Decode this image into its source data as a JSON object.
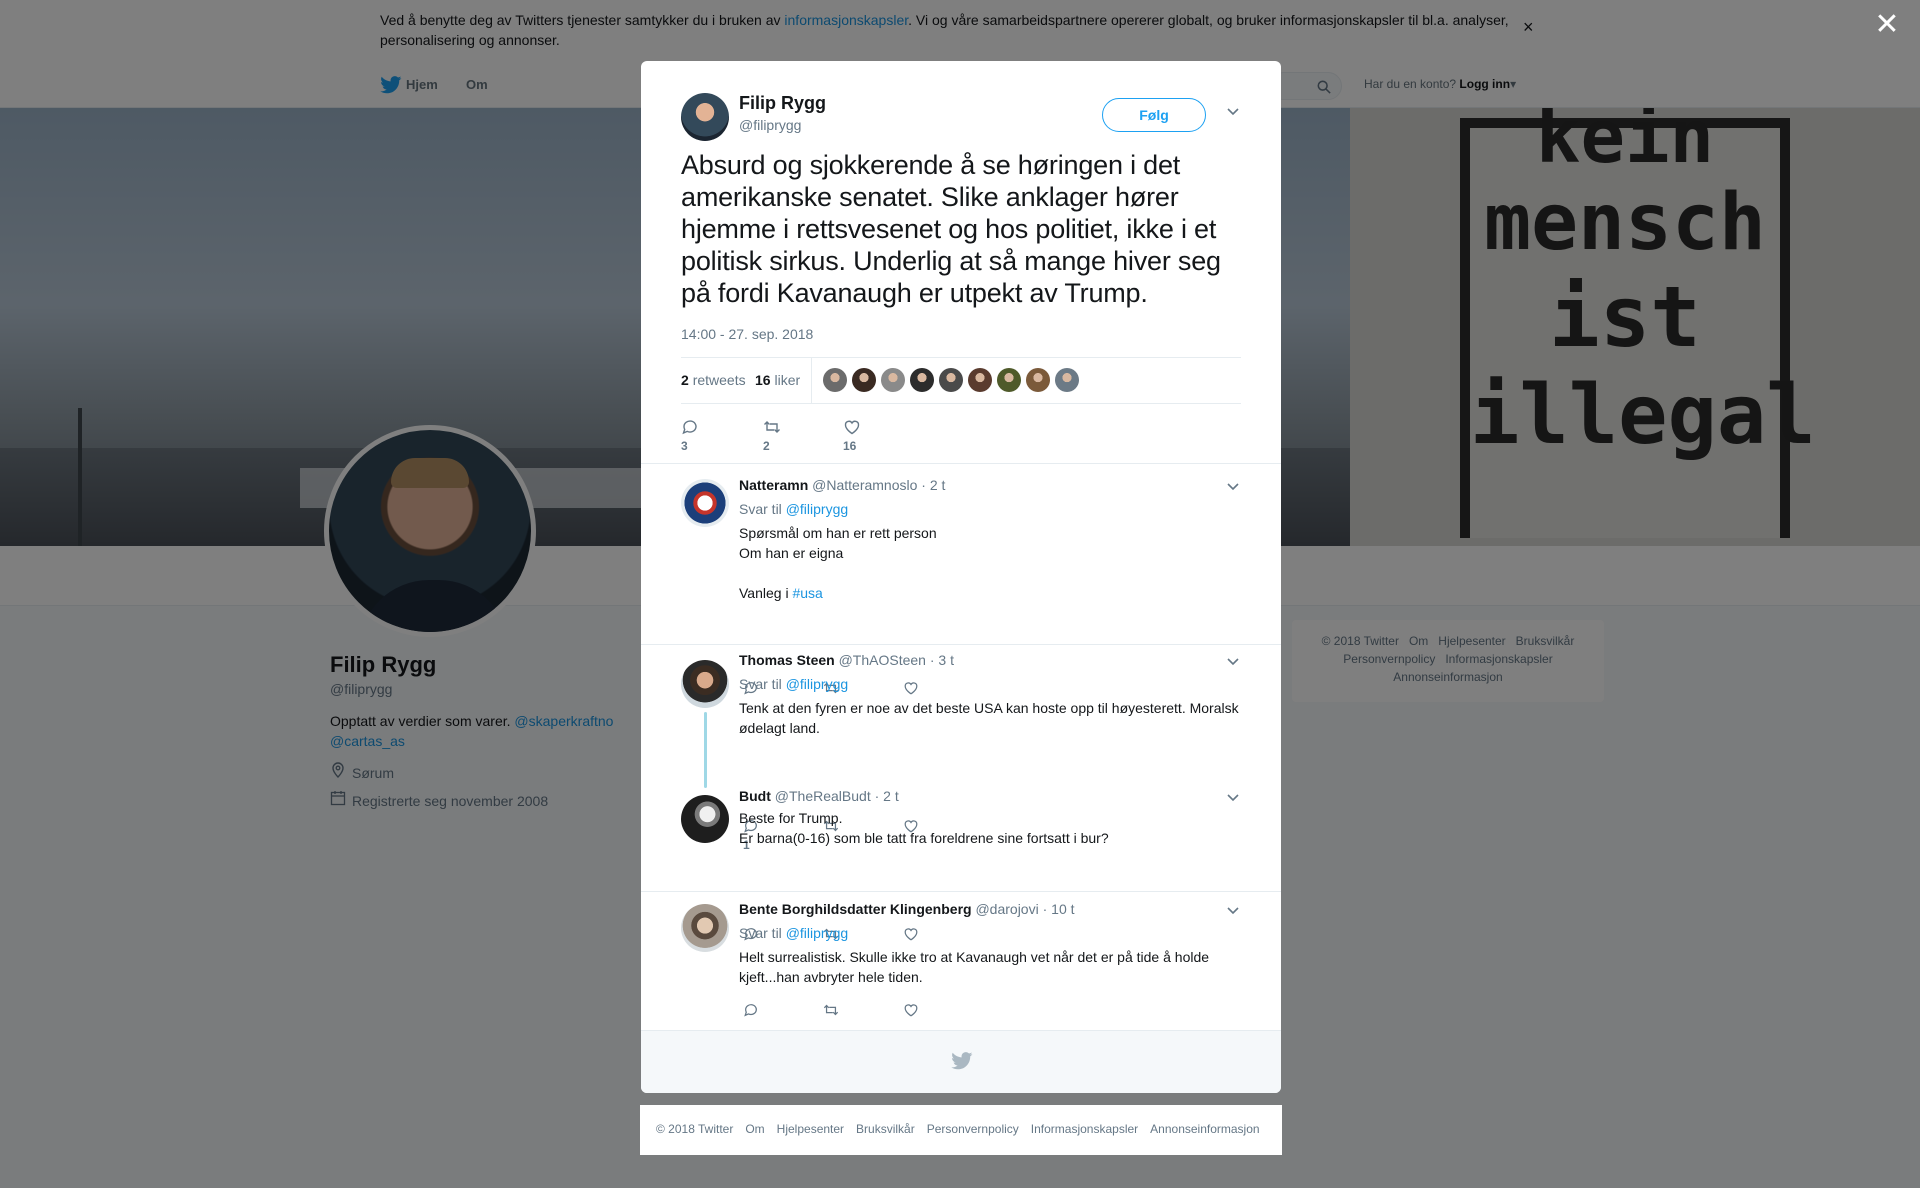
{
  "cookie": {
    "text_before": "Ved å benytte deg av Twitters tjenester samtykker du i bruken av ",
    "link": "informasjonskapsler",
    "text_after": ". Vi og våre samarbeidspartnere opererer globalt, og bruker informasjonskapsler til bl.a. analyser, personalisering og annonser.",
    "close": "×"
  },
  "nav": {
    "home": "Hjem",
    "about": "Om",
    "account_prompt": "Har du en konto?",
    "login": "Logg inn",
    "login_caret": "▾"
  },
  "banner": {
    "words": [
      "kein",
      "mensch",
      "ist",
      "illegal"
    ]
  },
  "profile": {
    "name": "Filip Rygg",
    "handle": "@filiprygg",
    "bio": "Opptatt av verdier som varer.",
    "bio_link1": "@skaperkraftno",
    "bio_link2": "@cartas_as",
    "location": "Sørum",
    "joined": "Registrerte seg november 2008"
  },
  "side_footer": {
    "items": [
      "© 2018 Twitter",
      "Om",
      "Hjelpesenter",
      "Bruksvilkår",
      "Personvernpolicy",
      "Informasjonskapsler",
      "Annonseinformasjon"
    ]
  },
  "overlay_close": "✕",
  "tweet": {
    "author_name": "Filip Rygg",
    "author_handle": "@filiprygg",
    "follow_label": "Følg",
    "caret": "⌄",
    "text": "Absurd og sjokkerende å se høringen i det amerikanske senatet. Slike anklager hører hjemme i rettsvesenet og hos politiet, ikke i et politisk sirkus. Underlig at så mange hiver seg på fordi Kavanaugh er utpekt av Trump.",
    "timestamp": "14:00 - 27. sep. 2018",
    "retweets_count": "2",
    "retweets_label": "retweets",
    "likes_count": "16",
    "likes_label": "liker",
    "liker_colors": [
      "#6b6b6b",
      "#3a2a22",
      "#8a8a8a",
      "#2c2c2c",
      "#4a4a4a",
      "#5a3b2e",
      "#4f5a2a",
      "#7b5a3a",
      "#6c7a86"
    ],
    "action_replies": "3",
    "action_retweets": "2",
    "action_likes": "16"
  },
  "replies": [
    {
      "name": "Natteramn",
      "handle": "@Natteramnoslo",
      "time": "· 2 t",
      "reply_to_label": "Svar til",
      "reply_to": "@filiprygg",
      "lines": [
        "Spørsmål om han er rett person",
        "Om han er eigna",
        "",
        "Vanleg i "
      ],
      "hashtag": "#usa",
      "reply_count": "",
      "avatar_color": "#1c3f7a"
    },
    {
      "name": "Thomas Steen",
      "handle": "@ThAOSteen",
      "time": "· 3 t",
      "reply_to_label": "Svar til",
      "reply_to": "@filiprygg",
      "text": "Tenk at den fyren er noe av det beste USA kan hoste opp til høyesterett. Moralsk ødelagt land.",
      "reply_count": "1",
      "avatar_color": "#4a3a2e"
    },
    {
      "name": "Budt",
      "handle": "@TheRealBudt",
      "time": "· 2 t",
      "lines": [
        "Beste for Trump.",
        "Er barna(0-16) som ble tatt fra foreldrene sine fortsatt i bur?"
      ],
      "reply_count": "",
      "avatar_color": "#2a2a2a"
    },
    {
      "name": "Bente Borghildsdatter Klingenberg",
      "handle": "@darojovi",
      "time": "· 10 t",
      "reply_to_label": "Svar til",
      "reply_to": "@filiprygg",
      "text": "Helt surrealistisk. Skulle ikke tro at Kavanaugh vet når det er på tide å holde kjeft...han avbryter hele tiden.",
      "reply_count": "",
      "avatar_color": "#8a7f74"
    }
  ],
  "bottom_footer": {
    "items": [
      "© 2018 Twitter",
      "Om",
      "Hjelpesenter",
      "Bruksvilkår",
      "Personvernpolicy",
      "Informasjonskapsler",
      "Annonseinformasjon"
    ]
  },
  "colors": {
    "link": "#1b95e0",
    "follow": "#1da1f2",
    "thread_line": "#9fd8e6"
  }
}
